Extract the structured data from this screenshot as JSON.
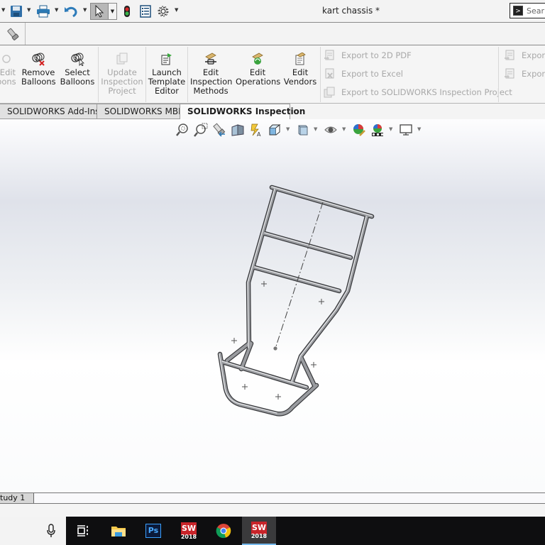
{
  "window": {
    "title": "kart chassis *",
    "search_placeholder": "Sear"
  },
  "quick_access": [
    {
      "name": "save",
      "icon": "save-icon"
    },
    {
      "name": "print",
      "icon": "print-icon"
    },
    {
      "name": "undo",
      "icon": "undo-icon"
    },
    {
      "name": "select",
      "icon": "cursor-icon",
      "active": true
    },
    {
      "name": "rebuild",
      "icon": "traffic-light-icon"
    },
    {
      "name": "file-properties",
      "icon": "file-properties-icon"
    },
    {
      "name": "options",
      "icon": "gear-icon"
    }
  ],
  "ribbon": {
    "buttons": [
      {
        "label_lines": [
          "/Edit",
          "oons"
        ],
        "enabled": false,
        "icon": "balloon-icon"
      },
      {
        "label_lines": [
          "Remove",
          "Balloons"
        ],
        "enabled": true,
        "icon": "remove-balloons-icon"
      },
      {
        "label_lines": [
          "Select",
          "Balloons"
        ],
        "enabled": true,
        "icon": "select-balloons-icon"
      },
      {
        "label_lines": [
          "Update",
          "Inspection",
          "Project"
        ],
        "enabled": false,
        "icon": "update-project-icon"
      },
      {
        "label_lines": [
          "Launch",
          "Template",
          "Editor"
        ],
        "enabled": true,
        "icon": "launch-template-icon"
      },
      {
        "label_lines": [
          "Edit",
          "Inspection",
          "Methods"
        ],
        "enabled": true,
        "icon": "edit-inspection-methods-icon"
      },
      {
        "label_lines": [
          "Edit",
          "Operations"
        ],
        "enabled": true,
        "icon": "edit-operations-icon"
      },
      {
        "label_lines": [
          "Edit",
          "Vendors"
        ],
        "enabled": true,
        "icon": "edit-vendors-icon"
      }
    ],
    "exports": [
      {
        "label": "Export to 2D PDF",
        "icon": "export-pdf-icon",
        "enabled": false
      },
      {
        "label": "Export to Excel",
        "icon": "export-excel-icon",
        "enabled": false
      },
      {
        "label": "Export to SOLIDWORKS Inspection Project",
        "icon": "export-project-icon",
        "enabled": false
      },
      {
        "label": "Export",
        "icon": "export-icon",
        "enabled": false
      },
      {
        "label": "Export",
        "icon": "export-icon",
        "enabled": false
      }
    ]
  },
  "tabs": [
    {
      "label": "SOLIDWORKS Add-Ins",
      "active": false
    },
    {
      "label": "SOLIDWORKS MBD",
      "active": false
    },
    {
      "label": "SOLIDWORKS Inspection",
      "active": true
    }
  ],
  "heads_up_toolbar": [
    "zoom-to-fit-icon",
    "zoom-to-area-icon",
    "previous-view-icon",
    "section-view-icon",
    "dynamic-annotation-icon",
    "view-orientation-icon",
    "display-style-icon",
    "hide-show-items-icon",
    "edit-appearance-icon",
    "apply-scene-icon",
    "view-settings-icon"
  ],
  "model": {
    "name": "kart chassis",
    "color_tube": "#8d8f93"
  },
  "bottom_tabs": [
    {
      "label": "tudy 1"
    }
  ],
  "taskbar": {
    "items": [
      {
        "name": "microphone",
        "icon": "microphone-icon"
      },
      {
        "name": "task-view",
        "icon": "task-view-icon"
      },
      {
        "name": "file-explorer",
        "icon": "folder-icon"
      },
      {
        "name": "photoshop",
        "icon": "photoshop-icon",
        "text": "Ps"
      },
      {
        "name": "solidworks-2018",
        "icon": "solidworks-icon",
        "text": "2018"
      },
      {
        "name": "chrome",
        "icon": "chrome-icon"
      },
      {
        "name": "solidworks-2018-active",
        "icon": "solidworks-icon",
        "text": "2018",
        "active": true
      }
    ]
  }
}
